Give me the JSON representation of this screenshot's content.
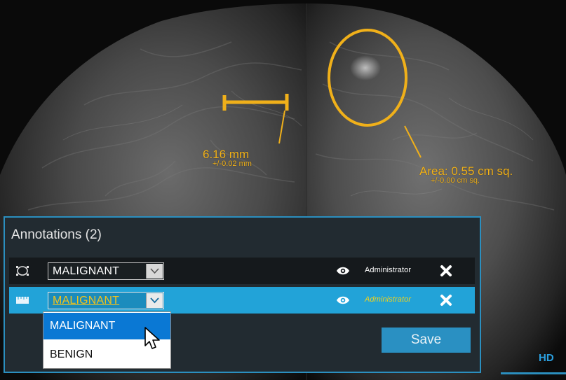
{
  "image": {
    "colors": {
      "accent": "#f2b21a",
      "panel_bg": "#222b31",
      "selected_row": "#22a3d8",
      "border": "#2b8fbf"
    }
  },
  "measurements": {
    "length_value": "6.16 mm",
    "length_tolerance": "+/-0.02 mm",
    "area_value": "Area: 0.55 cm sq.",
    "area_tolerance": "+/-0.00 cm sq."
  },
  "panel": {
    "title": "Annotations (2)",
    "rows": [
      {
        "icon": "ellipse-tool-icon",
        "classification": "MALIGNANT",
        "visibility_icon": "eye-icon",
        "author": "Administrator",
        "delete_icon": "close-icon"
      },
      {
        "icon": "ruler-tool-icon",
        "classification": "MALIGNANT",
        "visibility_icon": "eye-icon",
        "author": "Administrator",
        "delete_icon": "close-icon"
      }
    ],
    "save_label": "Save"
  },
  "dropdown": {
    "options": [
      "MALIGNANT",
      "BENIGN"
    ],
    "highlighted": "MALIGNANT"
  },
  "hd_badge": "HD"
}
